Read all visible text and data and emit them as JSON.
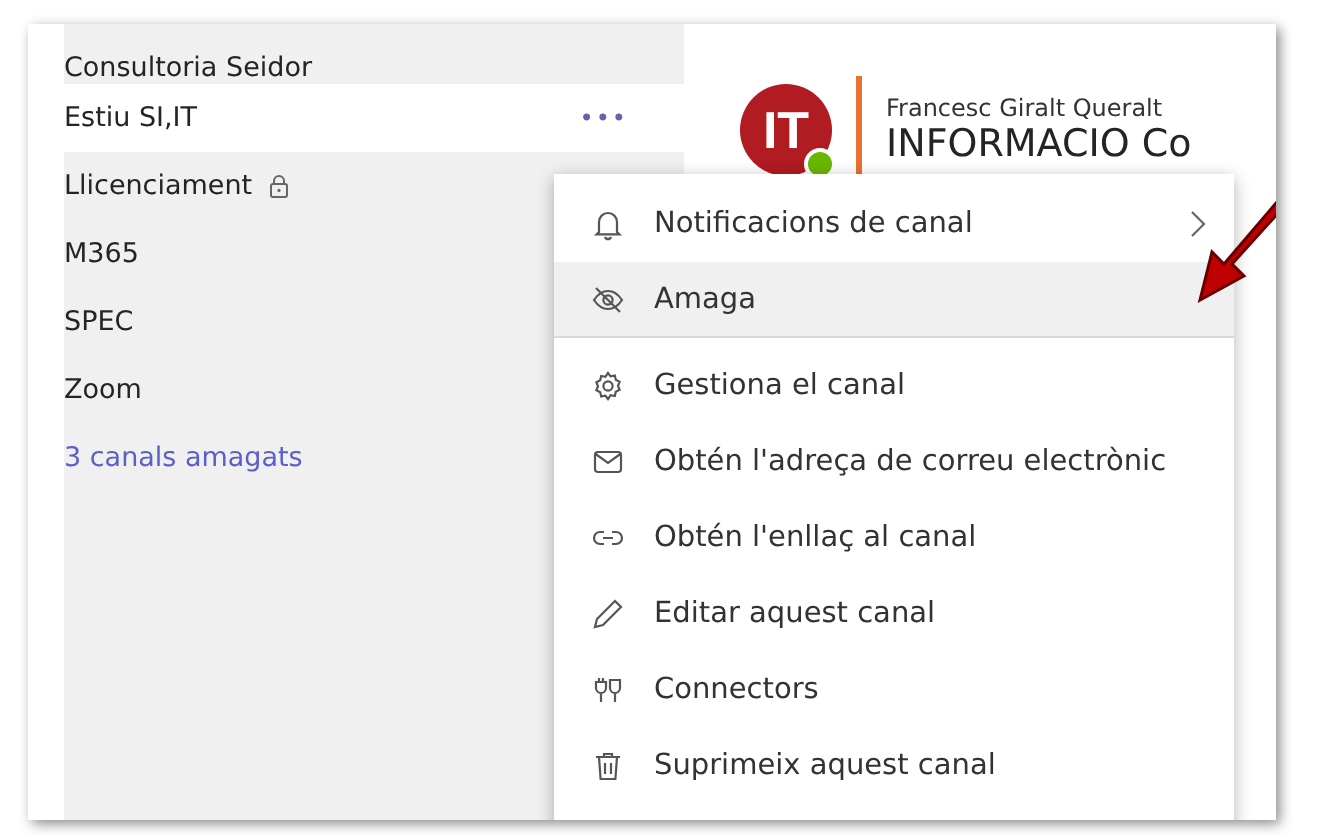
{
  "channels": [
    {
      "name": "Consultoria Seidor",
      "kind": "channel",
      "selected": false,
      "locked": false
    },
    {
      "name": "Estiu SI,IT",
      "kind": "channel",
      "selected": true,
      "locked": false,
      "more": "•••"
    },
    {
      "name": "Llicenciament",
      "kind": "channel",
      "selected": false,
      "locked": true
    },
    {
      "name": "M365",
      "kind": "channel",
      "selected": false,
      "locked": false
    },
    {
      "name": "SPEC",
      "kind": "channel",
      "selected": false,
      "locked": false
    },
    {
      "name": "Zoom",
      "kind": "channel",
      "selected": false,
      "locked": false
    },
    {
      "name": "3 canals amagats",
      "kind": "link",
      "selected": false,
      "locked": false
    }
  ],
  "post": {
    "avatar": "IT",
    "online": true,
    "author": "Francesc Giralt Queralt",
    "title": "INFORMACIO Co"
  },
  "menu": [
    {
      "label": "Notificacions de canal",
      "highlighted": false,
      "submenu": true,
      "divider_after": false
    },
    {
      "label": "Amaga",
      "highlighted": true,
      "submenu": false,
      "divider_after": true
    },
    {
      "label": "Gestiona el canal",
      "highlighted": false,
      "submenu": false,
      "divider_after": false
    },
    {
      "label": "Obtén l'adreça de correu electrònic",
      "highlighted": false,
      "submenu": false,
      "divider_after": false
    },
    {
      "label": "Obtén l'enllaç al canal",
      "highlighted": false,
      "submenu": false,
      "divider_after": false
    },
    {
      "label": "Editar aquest canal",
      "highlighted": false,
      "submenu": false,
      "divider_after": false
    },
    {
      "label": "Connectors",
      "highlighted": false,
      "submenu": false,
      "divider_after": false
    },
    {
      "label": "Suprimeix aquest canal",
      "highlighted": false,
      "submenu": false,
      "divider_after": false
    }
  ]
}
